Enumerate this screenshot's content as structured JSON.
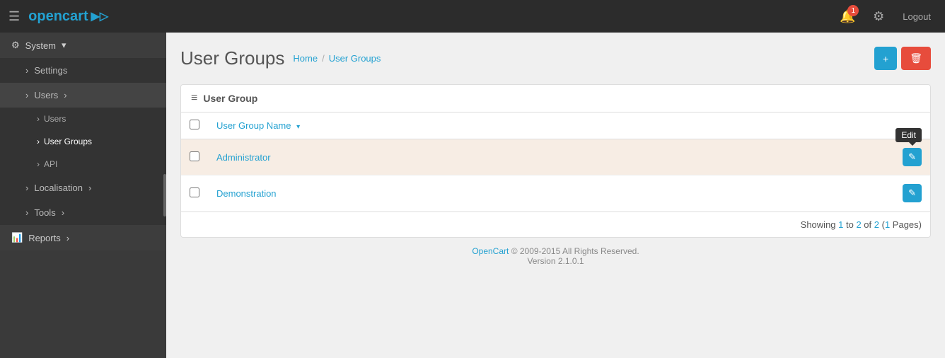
{
  "navbar": {
    "logo": "opencart",
    "logo_symbol": "▶▷",
    "hamburger_icon": "☰",
    "notification_count": "1",
    "logout_label": "Logout"
  },
  "sidebar": {
    "items": [
      {
        "id": "system",
        "label": "System",
        "icon": "⚙",
        "expanded": true
      },
      {
        "id": "settings",
        "label": "Settings",
        "icon": "›",
        "indent": 1
      },
      {
        "id": "users",
        "label": "Users",
        "icon": "›",
        "indent": 1,
        "expanded": true
      },
      {
        "id": "users-sub",
        "label": "Users",
        "icon": "›",
        "indent": 2
      },
      {
        "id": "user-groups",
        "label": "User Groups",
        "icon": "›",
        "indent": 2,
        "active": true
      },
      {
        "id": "api",
        "label": "API",
        "icon": "›",
        "indent": 2
      },
      {
        "id": "localisation",
        "label": "Localisation",
        "icon": "›",
        "indent": 1
      },
      {
        "id": "tools",
        "label": "Tools",
        "icon": "›",
        "indent": 1
      },
      {
        "id": "reports",
        "label": "Reports",
        "icon": "📊",
        "indent": 0
      }
    ]
  },
  "page": {
    "title": "User Groups",
    "breadcrumb": {
      "home": "Home",
      "current": "User Groups"
    },
    "add_button": "+",
    "delete_button": "🗑"
  },
  "card": {
    "header_icon": "≡",
    "header_title": "User Group"
  },
  "table": {
    "columns": [
      {
        "id": "checkbox",
        "label": ""
      },
      {
        "id": "name",
        "label": "User Group Name",
        "sortable": true
      },
      {
        "id": "action",
        "label": ""
      }
    ],
    "rows": [
      {
        "id": 1,
        "name": "Administrator",
        "edit_label": "✎",
        "tooltip": "Edit",
        "highlighted": true
      },
      {
        "id": 2,
        "name": "Demonstration",
        "edit_label": "✎",
        "tooltip": "",
        "highlighted": false
      }
    ],
    "pagination": {
      "text": "Showing 1 to 2 of 2 (1 Pages)",
      "highlight_start": "1",
      "highlight_end": "2",
      "highlight_total": "2",
      "highlight_pages": "1"
    }
  },
  "footer": {
    "brand": "OpenCart",
    "copyright": "© 2009-2015 All Rights Reserved.",
    "version": "Version 2.1.0.1"
  }
}
